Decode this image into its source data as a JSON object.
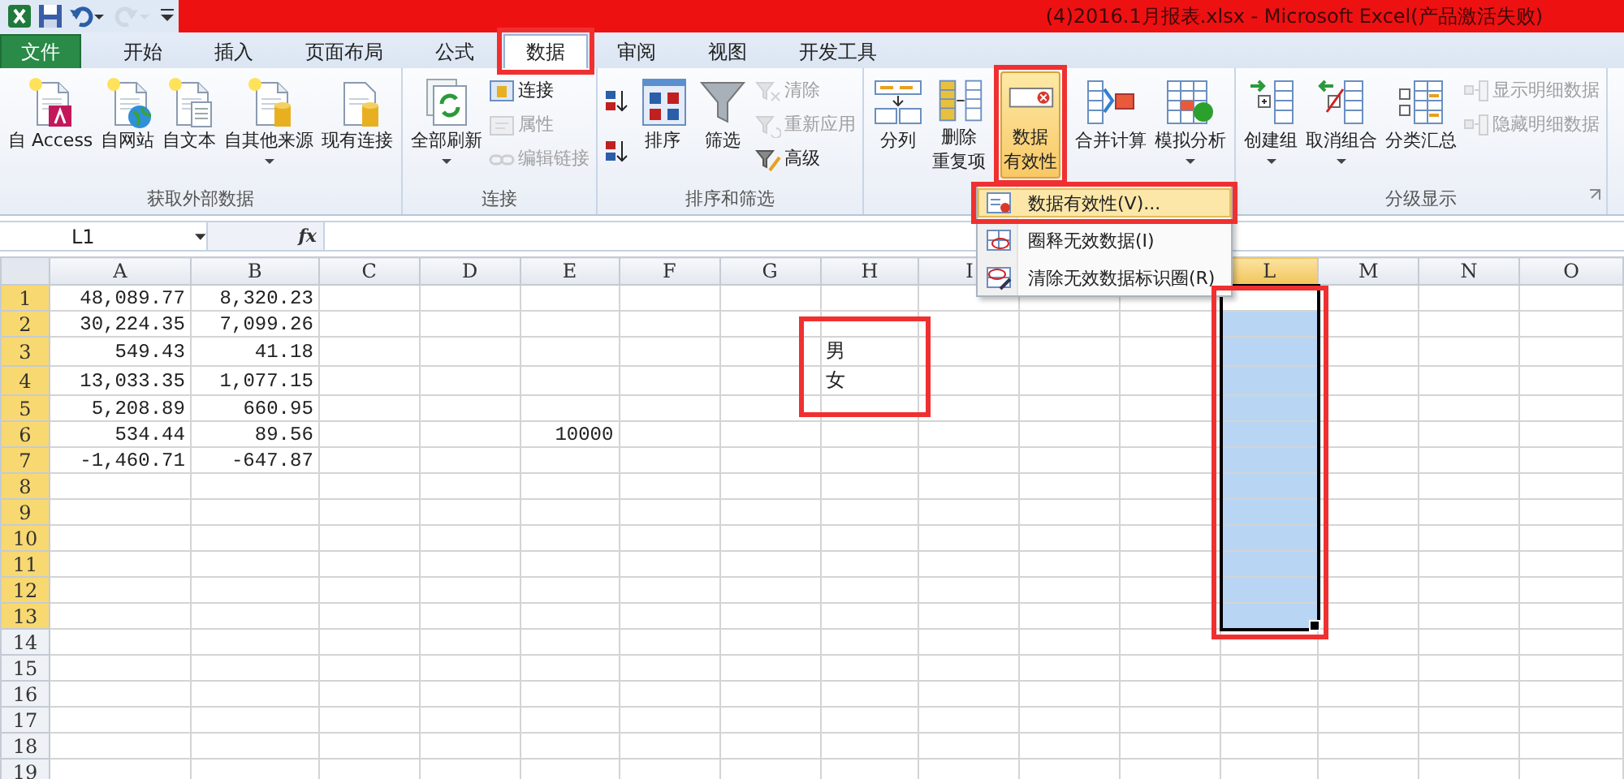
{
  "quick_access": [
    {
      "kind": "app",
      "disabled": false
    },
    {
      "kind": "save",
      "disabled": false
    },
    {
      "kind": "undo",
      "disabled": false
    },
    {
      "kind": "redo",
      "disabled": true
    },
    {
      "kind": "customize",
      "disabled": false
    }
  ],
  "window": {
    "title": "(4)2016.1月报表.xlsx  -  Microsoft Excel(产品激活失败)"
  },
  "tabs": [
    {
      "label": "文件",
      "kind": "file",
      "selected": false
    },
    {
      "label": "开始",
      "kind": "tab",
      "selected": false
    },
    {
      "label": "插入",
      "kind": "tab",
      "selected": false
    },
    {
      "label": "页面布局",
      "kind": "tab",
      "selected": false
    },
    {
      "label": "公式",
      "kind": "tab",
      "selected": false
    },
    {
      "label": "数据",
      "kind": "tab",
      "selected": true
    },
    {
      "label": "审阅",
      "kind": "tab",
      "selected": false
    },
    {
      "label": "视图",
      "kind": "tab",
      "selected": false
    },
    {
      "label": "开发工具",
      "kind": "tab",
      "selected": false
    }
  ],
  "ribbon_groups": [
    {
      "label": "获取外部数据",
      "items": [
        {
          "kind": "large",
          "lines": [
            "自 Access"
          ],
          "dropdown": false,
          "pressed": false
        },
        {
          "kind": "large",
          "lines": [
            "自网站"
          ],
          "dropdown": false,
          "pressed": false
        },
        {
          "kind": "large",
          "lines": [
            "自文本"
          ],
          "dropdown": false,
          "pressed": false
        },
        {
          "kind": "large",
          "lines": [
            "自其他来源"
          ],
          "dropdown": true,
          "pressed": false
        },
        {
          "kind": "large",
          "lines": [
            "现有连接"
          ],
          "dropdown": false,
          "pressed": false
        }
      ]
    },
    {
      "label": "连接",
      "items": [
        {
          "kind": "large",
          "lines": [
            "全部刷新"
          ],
          "dropdown": true,
          "pressed": false
        },
        {
          "kind": "stack",
          "buttons": [
            {
              "label": "连接",
              "disabled": false
            },
            {
              "label": "属性",
              "disabled": true
            },
            {
              "label": "编辑链接",
              "disabled": true
            }
          ]
        }
      ]
    },
    {
      "label": "排序和筛选",
      "items": [
        {
          "kind": "stack",
          "buttons": [
            {
              "disabled": false
            },
            {
              "disabled": false
            }
          ]
        },
        {
          "kind": "large",
          "lines": [
            "排序"
          ],
          "dropdown": false,
          "pressed": false
        },
        {
          "kind": "large",
          "lines": [
            "筛选"
          ],
          "dropdown": false,
          "pressed": false
        },
        {
          "kind": "stack",
          "buttons": [
            {
              "label": "清除",
              "disabled": true
            },
            {
              "label": "重新应用",
              "disabled": true
            },
            {
              "label": "高级",
              "disabled": false
            }
          ]
        }
      ]
    },
    {
      "items": [
        {
          "kind": "large",
          "lines": [
            "分列"
          ],
          "dropdown": false,
          "pressed": false
        },
        {
          "kind": "large",
          "lines": [
            "删除",
            "重复项"
          ],
          "dropdown": false,
          "pressed": false
        },
        {
          "kind": "large",
          "lines": [
            "数据",
            "有效性"
          ],
          "dropdown": false,
          "pressed": true
        },
        {
          "kind": "large",
          "lines": [
            "合并计算"
          ],
          "dropdown": false,
          "pressed": false
        },
        {
          "kind": "large",
          "lines": [
            "模拟分析"
          ],
          "dropdown": true,
          "pressed": false
        }
      ]
    },
    {
      "label": "分级显示",
      "items": [
        {
          "kind": "large",
          "lines": [
            "创建组"
          ],
          "dropdown": true,
          "pressed": false
        },
        {
          "kind": "large",
          "lines": [
            "取消组合"
          ],
          "dropdown": true,
          "pressed": false
        },
        {
          "kind": "large",
          "lines": [
            "分类汇总"
          ],
          "dropdown": false,
          "pressed": false
        },
        {
          "kind": "stack",
          "buttons": [
            {
              "label": "显示明细数据",
              "disabled": true
            },
            {
              "label": "隐藏明细数据",
              "disabled": true
            }
          ]
        }
      ]
    }
  ],
  "dropdown_menu": {
    "items": [
      {
        "label": "数据有效性(V)...",
        "selected": true
      },
      {
        "label": "圈释无效数据(I)",
        "selected": false
      },
      {
        "label": "清除无效数据标识圈(R)",
        "selected": false
      }
    ]
  },
  "formula_bar": {
    "name_box": "L1",
    "function_button": "fx"
  },
  "sheet": {
    "columns": [
      {
        "label": "A",
        "selected": false
      },
      {
        "label": "B",
        "selected": false
      },
      {
        "label": "C",
        "selected": false
      },
      {
        "label": "D",
        "selected": false
      },
      {
        "label": "E",
        "selected": false
      },
      {
        "label": "F",
        "selected": false
      },
      {
        "label": "G",
        "selected": false
      },
      {
        "label": "H",
        "selected": false
      },
      {
        "label": "I",
        "selected": false
      },
      {
        "selected": false
      },
      {
        "selected": false
      },
      {
        "label": "L",
        "selected": true
      },
      {
        "label": "M",
        "selected": false
      },
      {
        "label": "N",
        "selected": false
      },
      {
        "label": "O",
        "selected": false
      }
    ],
    "rows": [
      {
        "header": "1",
        "selected": true,
        "cells": {
          "A": "48,089.77",
          "B": "8,320.23"
        }
      },
      {
        "header": "2",
        "selected": true,
        "cells": {
          "A": "30,224.35",
          "B": "7,099.26"
        }
      },
      {
        "header": "3",
        "selected": true,
        "cells": {
          "A": "549.43",
          "B": "41.18",
          "H": "男"
        }
      },
      {
        "header": "4",
        "selected": true,
        "cells": {
          "A": "13,033.35",
          "B": "1,077.15",
          "H": "女"
        }
      },
      {
        "header": "5",
        "selected": true,
        "cells": {
          "A": "5,208.89",
          "B": "660.95"
        }
      },
      {
        "header": "6",
        "selected": true,
        "cells": {
          "A": "534.44",
          "B": "89.56",
          "E": "10000"
        }
      },
      {
        "header": "7",
        "selected": true,
        "cells": {
          "A": "-1,460.71",
          "B": "-647.87"
        }
      },
      {
        "header": "8",
        "selected": true
      },
      {
        "header": "9",
        "selected": true
      },
      {
        "header": "10",
        "selected": true
      },
      {
        "header": "11",
        "selected": true
      },
      {
        "header": "12",
        "selected": true
      },
      {
        "header": "13",
        "selected": true
      },
      {
        "header": "14",
        "selected": false
      },
      {
        "header": "15",
        "selected": false
      },
      {
        "header": "16",
        "selected": false
      },
      {
        "header": "17",
        "selected": false
      },
      {
        "header": "18",
        "selected": false
      },
      {
        "header": "19",
        "selected": false
      }
    ]
  }
}
